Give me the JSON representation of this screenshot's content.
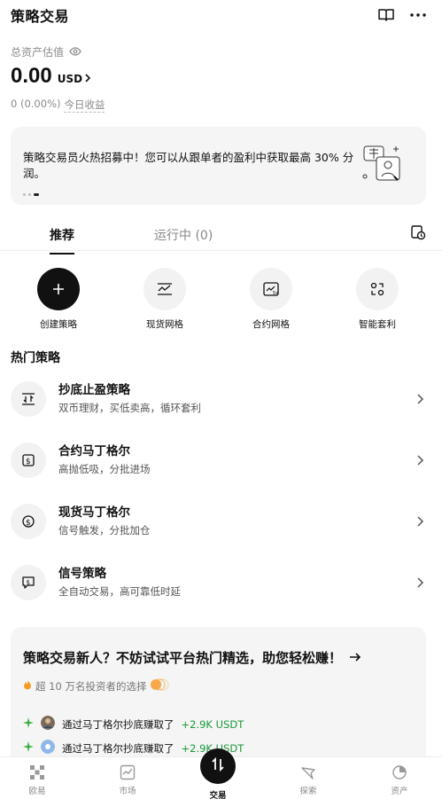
{
  "header": {
    "title": "策略交易"
  },
  "assets": {
    "label": "总资产估值",
    "amount": "0.00",
    "currency": "USD",
    "pnl_value": "0 (0.00%)",
    "pnl_label": "今日收益"
  },
  "banner": {
    "text": "策略交易员火热招募中！您可以从跟单者的盈利中获取最高 30% 分润。"
  },
  "tabs": {
    "recommended": "推荐",
    "running": "运行中 (0)"
  },
  "quick_actions": [
    {
      "label": "创建策略",
      "icon": "plus-icon"
    },
    {
      "label": "现货网格",
      "icon": "grid-chart-icon"
    },
    {
      "label": "合约网格",
      "icon": "contract-grid-icon"
    },
    {
      "label": "智能套利",
      "icon": "arbitrage-icon"
    }
  ],
  "hot_section": {
    "title": "热门策略"
  },
  "strategies": [
    {
      "name": "抄底止盈策略",
      "desc": "双币理财，买低卖高，循环套利",
      "icon": "buy-low-icon"
    },
    {
      "name": "合约马丁格尔",
      "desc": "高抛低吸，分批进场",
      "icon": "contract-martingale-icon"
    },
    {
      "name": "现货马丁格尔",
      "desc": "信号触发，分批加仓",
      "icon": "spot-martingale-icon"
    },
    {
      "name": "信号策略",
      "desc": "全自动交易，高可靠低时延",
      "icon": "signal-icon"
    }
  ],
  "promo": {
    "title": "策略交易新人？不妨试试平台热门精选，助您轻松赚！",
    "subtitle": "超 10 万名投资者的选择",
    "feed": [
      {
        "text": "通过马丁格尔抄底赚取了",
        "gain": "+2.9K USDT"
      },
      {
        "text": "通过马丁格尔抄底赚取了",
        "gain": "+2.9K USDT"
      }
    ]
  },
  "bottom_nav": {
    "items": [
      "欧易",
      "市场",
      "交易",
      "探索",
      "资产"
    ]
  },
  "colors": {
    "gain": "#1a9a3a",
    "dark": "#111111",
    "surface": "#f5f5f5"
  }
}
